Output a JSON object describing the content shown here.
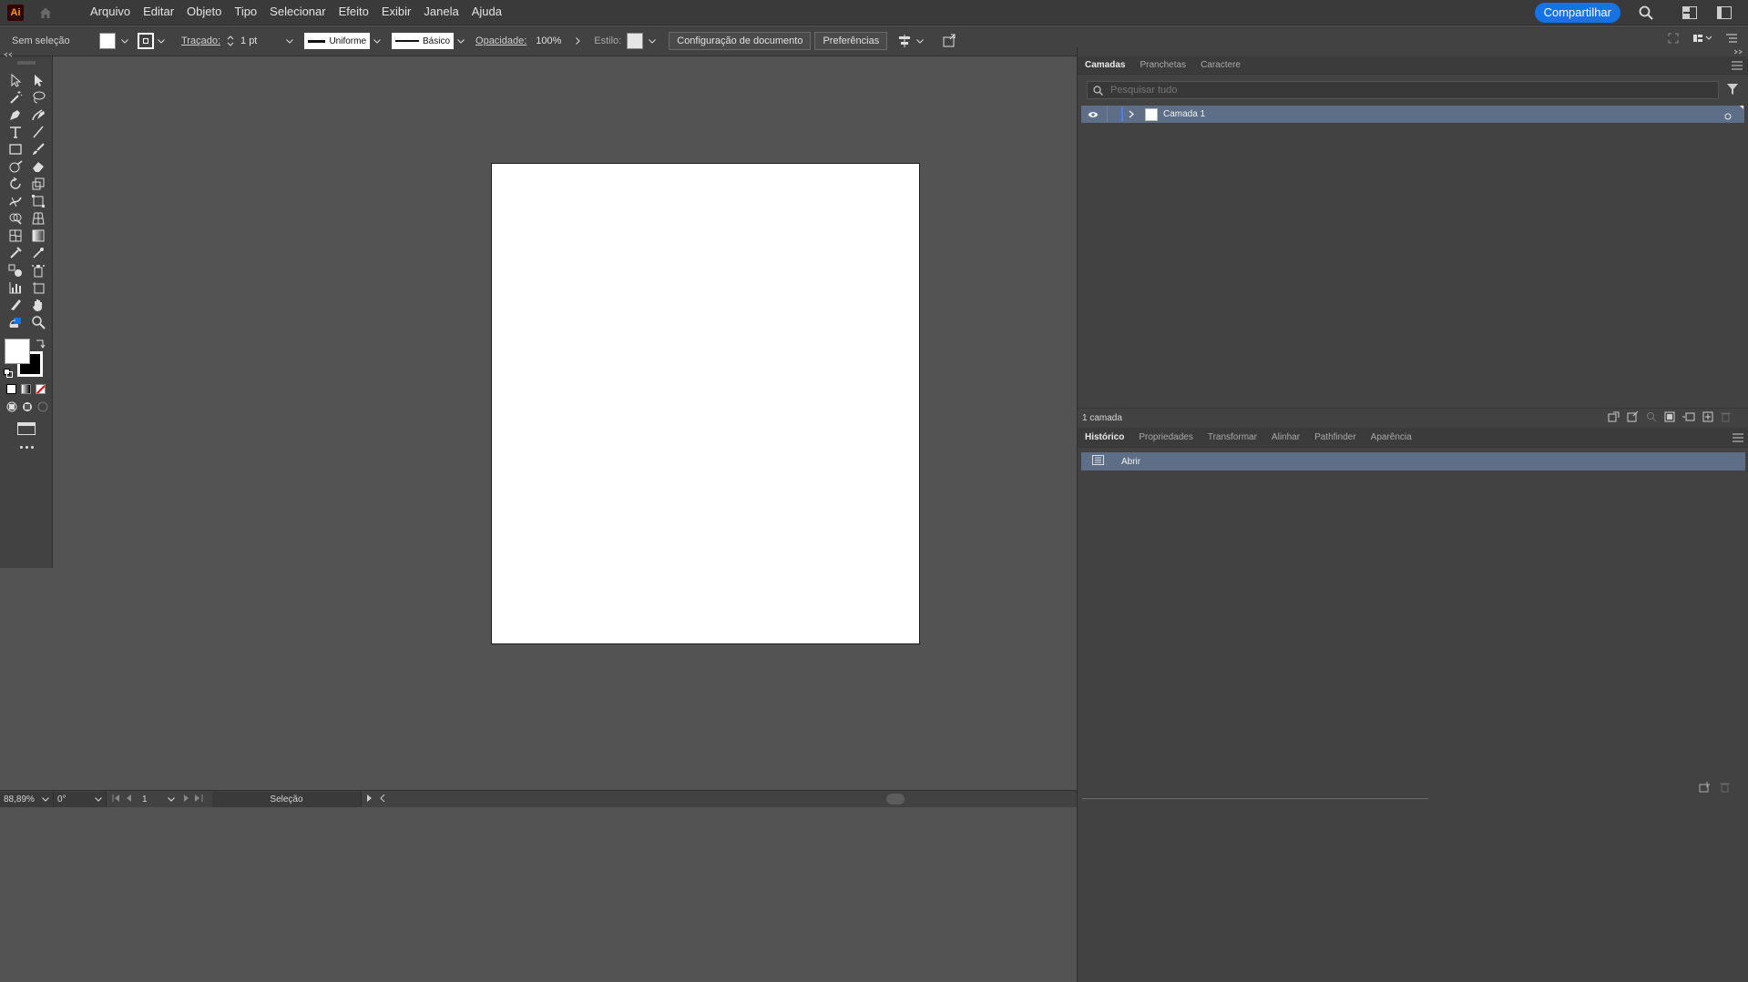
{
  "app": {
    "logo_text": "Ai",
    "share_label": "Compartilhar"
  },
  "menu": [
    "Arquivo",
    "Editar",
    "Objeto",
    "Tipo",
    "Selecionar",
    "Efeito",
    "Exibir",
    "Janela",
    "Ajuda"
  ],
  "control": {
    "selection_status": "Sem seleção",
    "stroke_label": "Traçado:",
    "stroke_weight": "1 pt",
    "profile_label": "Uniforme",
    "brush_label": "Básico",
    "opacity_label": "Opacidade:",
    "opacity_value": "100%",
    "style_label": "Estilo:",
    "doc_setup_label": "Configuração de documento",
    "prefs_label": "Preferências"
  },
  "panels": {
    "top_tabs": [
      "Camadas",
      "Pranchetas",
      "Caractere"
    ],
    "search_placeholder": "Pesquisar tudo",
    "layers": [
      {
        "name": "Camada 1"
      }
    ],
    "layer_count": "1 camada",
    "bottom_tabs": [
      "Histórico",
      "Propriedades",
      "Transformar",
      "Alinhar",
      "Pathfinder",
      "Aparência"
    ],
    "history": [
      {
        "label": "Abrir"
      }
    ]
  },
  "status": {
    "zoom": "88,89%",
    "rotation": "0°",
    "artboard_number": "1",
    "tool_name": "Seleção"
  },
  "colors": {
    "accent": "#1473e6",
    "selection_row": "#5d6e86",
    "canvas": "#535353",
    "artboard": "#ffffff"
  }
}
